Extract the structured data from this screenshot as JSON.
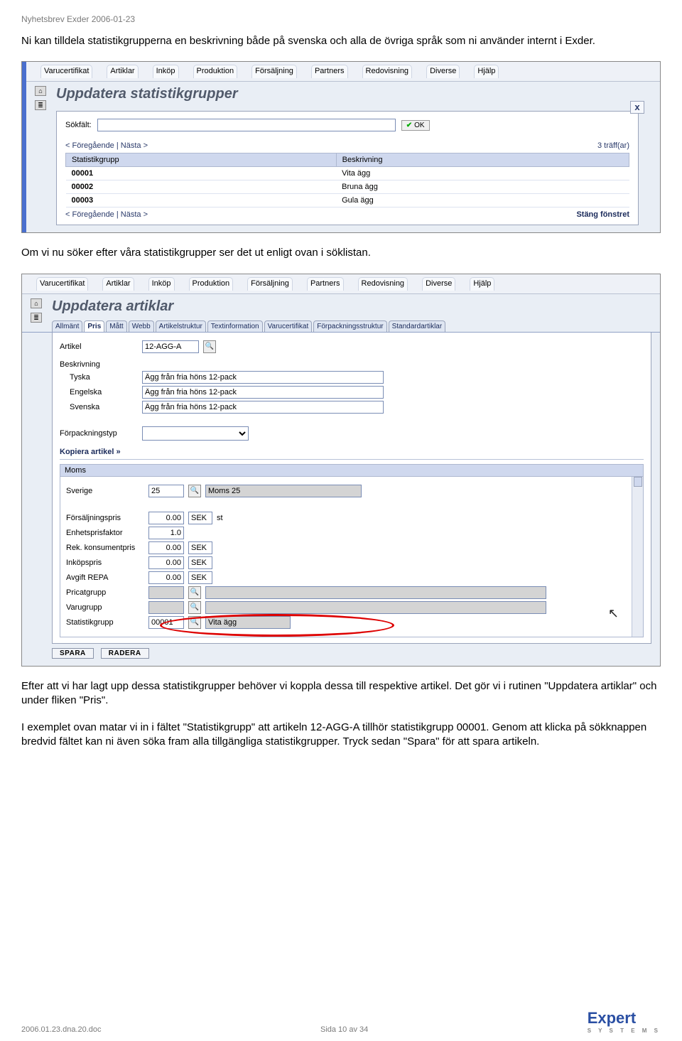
{
  "header_meta": "Nyhetsbrev Exder 2006-01-23",
  "para1": "Ni kan tilldela statistikgrupperna en beskrivning både på svenska och alla de övriga språk som ni använder internt i Exder.",
  "shot1": {
    "tabs": [
      "Varucertifikat",
      "Artiklar",
      "Inköp",
      "Produktion",
      "Försäljning",
      "Partners",
      "Redovisning",
      "Diverse",
      "Hjälp"
    ],
    "title": "Uppdatera statistikgrupper",
    "close": "x",
    "search_label": "Sökfält:",
    "ok": "OK",
    "pager_left": "< Föregående | Nästa >",
    "hits": "3 träff(ar)",
    "col1": "Statistikgrupp",
    "col2": "Beskrivning",
    "rows": [
      {
        "c1": "00001",
        "c2": "Vita ägg"
      },
      {
        "c1": "00002",
        "c2": "Bruna ägg"
      },
      {
        "c1": "00003",
        "c2": "Gula ägg"
      }
    ],
    "close_window": "Stäng fönstret"
  },
  "para2": "Om vi nu söker efter våra statistikgrupper ser det ut enligt ovan i söklistan.",
  "shot2": {
    "tabs": [
      "Varucertifikat",
      "Artiklar",
      "Inköp",
      "Produktion",
      "Försäljning",
      "Partners",
      "Redovisning",
      "Diverse",
      "Hjälp"
    ],
    "title": "Uppdatera artiklar",
    "subtabs": [
      "Allmänt",
      "Pris",
      "Mått",
      "Webb",
      "Artikelstruktur",
      "Textinformation",
      "Varucertifikat",
      "Förpackningsstruktur",
      "Standardartiklar"
    ],
    "artikel_label": "Artikel",
    "artikel_value": "12-AGG-A",
    "beskrivning_label": "Beskrivning",
    "lang_tyska": "Tyska",
    "lang_engelska": "Engelska",
    "lang_svenska": "Svenska",
    "desc_value": "Ägg från fria höns 12-pack",
    "forpack_label": "Förpackningstyp",
    "kopiera": "Kopiera artikel »",
    "moms_head": "Moms",
    "moms_country": "Sverige",
    "moms_val": "25",
    "moms_desc": "Moms 25",
    "rows2": [
      {
        "l": "Försäljningspris",
        "v": "0.00",
        "u": "SEK",
        "t": "st"
      },
      {
        "l": "Enhetsprisfaktor",
        "v": "1.0",
        "u": "",
        "t": ""
      },
      {
        "l": "Rek. konsumentpris",
        "v": "0.00",
        "u": "SEK",
        "t": ""
      },
      {
        "l": "Inköpspris",
        "v": "0.00",
        "u": "SEK",
        "t": ""
      },
      {
        "l": "Avgift REPA",
        "v": "0.00",
        "u": "SEK",
        "t": ""
      }
    ],
    "pricegroup_label": "Pricatgrupp",
    "varugrupp_label": "Varugrupp",
    "statgrupp_label": "Statistikgrupp",
    "statgrupp_value": "00001",
    "statgrupp_desc": "Vita ägg",
    "btn_save": "SPARA",
    "btn_delete": "RADERA"
  },
  "para3": "Efter att vi har lagt upp dessa statistikgrupper behöver vi koppla dessa till respektive artikel. Det gör vi i rutinen \"Uppdatera artiklar\" och under fliken \"Pris\".",
  "para4": "I exemplet ovan matar vi in i fältet \"Statistikgrupp\" att artikeln 12-AGG-A tillhör statistikgrupp 00001. Genom att klicka på sökknappen bredvid fältet kan ni även söka fram alla tillgängliga statistikgrupper. Tryck sedan \"Spara\" för att spara artikeln.",
  "footer_left": "2006.01.23.dna.20.doc",
  "footer_center": "Sida 10 av 34",
  "logo_text": "Expert",
  "logo_sub": "S Y S T E M S"
}
